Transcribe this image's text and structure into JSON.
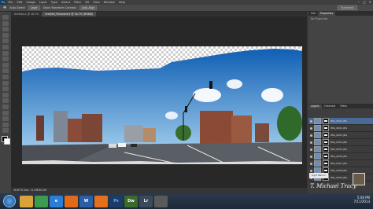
{
  "menubar": {
    "logo": "Ps",
    "items": [
      "File",
      "Edit",
      "Image",
      "Layer",
      "Type",
      "Select",
      "Filter",
      "3D",
      "View",
      "Window",
      "Help"
    ]
  },
  "options": {
    "items": [
      "Auto-Select",
      "Layer",
      "Show Transform Controls",
      "Auto-Align"
    ],
    "workspace": "Essentials"
  },
  "tabs": [
    "Untitled-1 @ 16.7%",
    "Untitled_Panorama1 @ 16.7% (RGB/8)"
  ],
  "status": "16.67%  Doc: 11.5M/90.2M",
  "panels": {
    "top_tabs": [
      "Info",
      "Properties"
    ],
    "props_label": "No Properties",
    "layer_tabs": [
      "Layers",
      "Channels",
      "Paths"
    ],
    "layers": [
      {
        "name": "IMG_0001.JPG"
      },
      {
        "name": "IMG_0002.JPG"
      },
      {
        "name": "IMG_0003.JPG"
      },
      {
        "name": "IMG_0004.JPG"
      },
      {
        "name": "IMG_0005.JPG"
      },
      {
        "name": "IMG_0006.JPG"
      },
      {
        "name": "IMG_0007.JPG"
      },
      {
        "name": "IMG_0008.JPG"
      },
      {
        "name": "IMG_0009.JPG"
      }
    ]
  },
  "watermark": {
    "title": "Light Warrior",
    "name": "T. Michael Tracy"
  },
  "taskbar": {
    "apps": [
      {
        "icon": "folder-icon",
        "label": "",
        "color": "#d9a33a"
      },
      {
        "icon": "chrome-icon",
        "label": "",
        "color": "#3c9b4c"
      },
      {
        "icon": "ie-icon",
        "label": "e",
        "color": "#2a7fd4"
      },
      {
        "icon": "media-icon",
        "label": "",
        "color": "#e06a1a"
      },
      {
        "icon": "word-icon",
        "label": "W",
        "color": "#2a5ea8"
      },
      {
        "icon": "firefox-icon",
        "label": "",
        "color": "#e2701c"
      },
      {
        "icon": "photoshop-icon",
        "label": "Ps",
        "color": "#1a3c66"
      },
      {
        "icon": "dreamweaver-icon",
        "label": "Dw",
        "color": "#3b6b2a"
      },
      {
        "icon": "lightroom-icon",
        "label": "Lr",
        "color": "#3a4a5a"
      },
      {
        "icon": "other-icon",
        "label": "",
        "color": "#5a5a5a"
      }
    ],
    "time": "5:08 PM",
    "date": "7/11/2013"
  },
  "accent": "#4a6a96"
}
